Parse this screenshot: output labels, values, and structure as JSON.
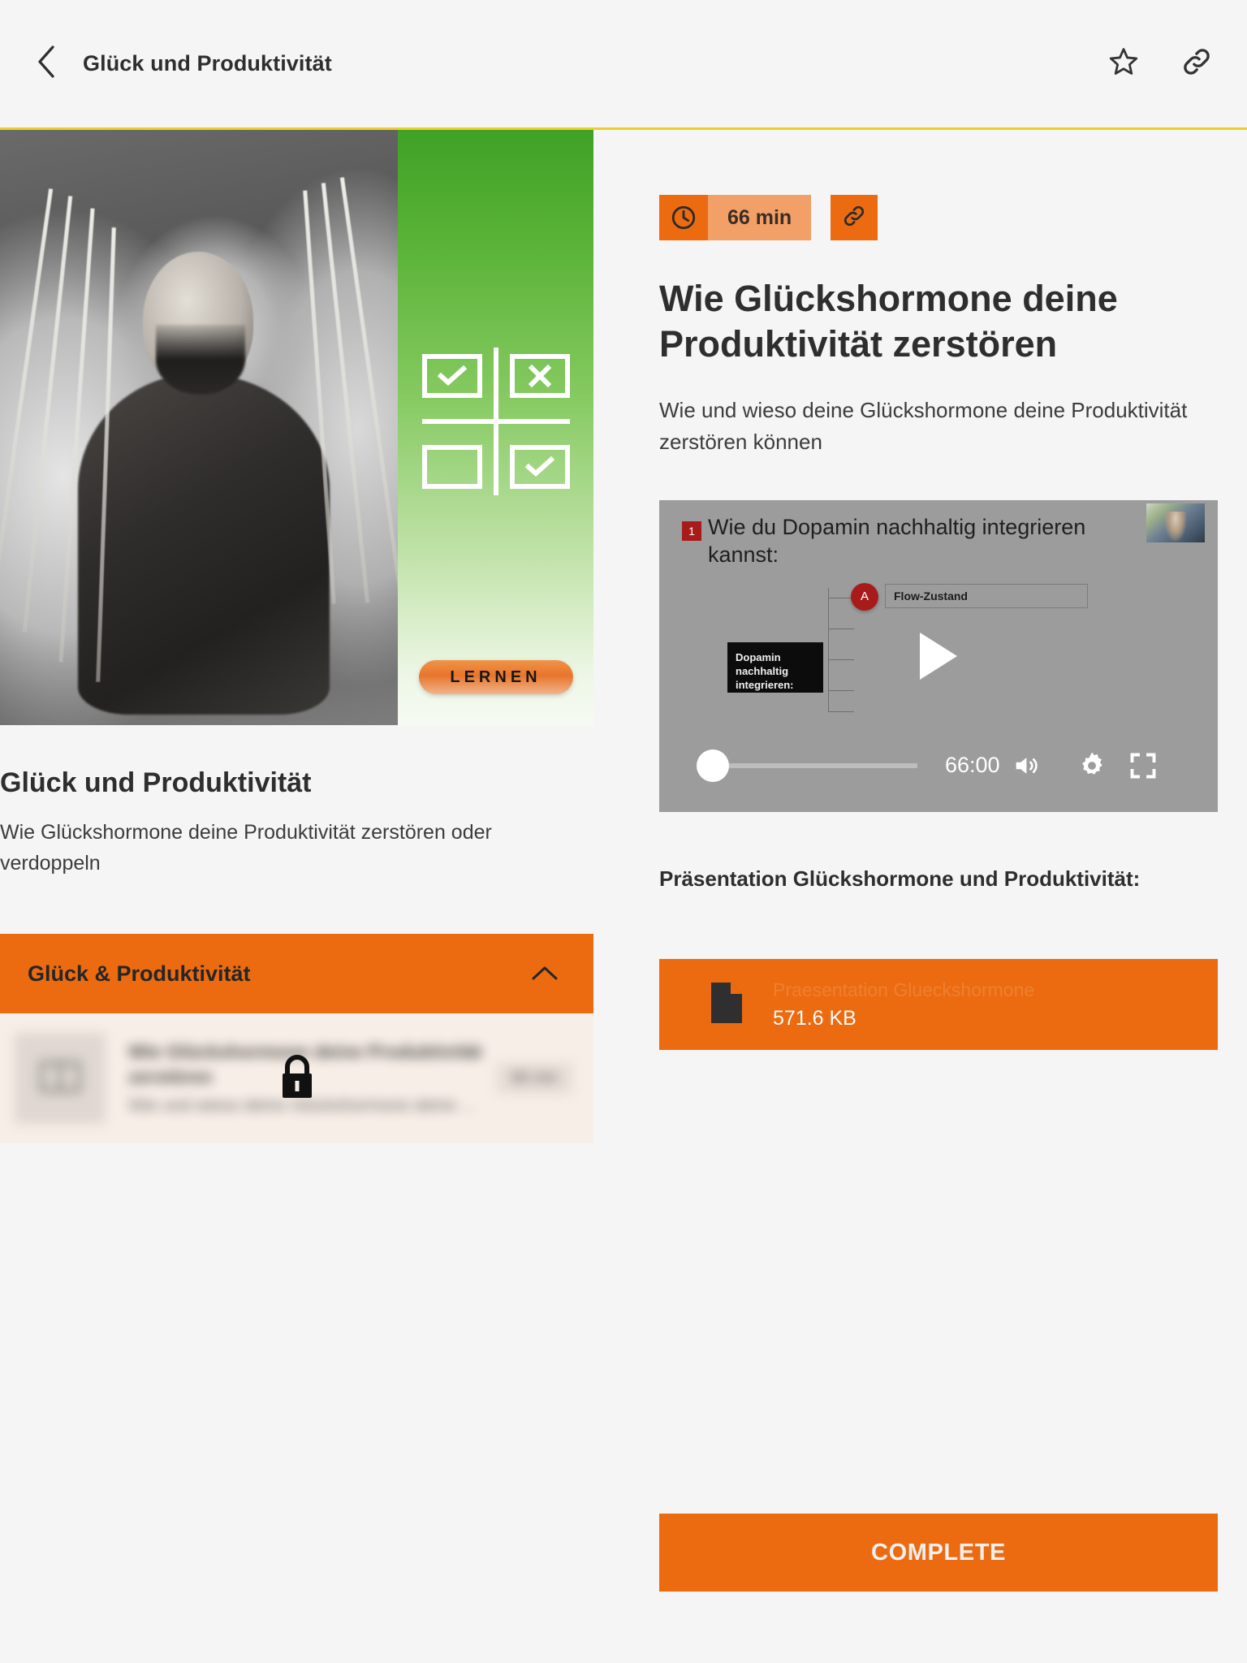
{
  "header": {
    "back_icon": "chevron-left-icon",
    "title": "Glück und Produktivität",
    "favorite_icon": "star-icon",
    "share_icon": "link-icon",
    "divider_color": "#e9cf2b"
  },
  "course": {
    "title": "Glück und Produktivität",
    "description": "Wie Glückshormone deine Produktivität zerstören oder verdoppeln",
    "cover": {
      "photo_alt": "man-in-hammock-photo",
      "badge_label": "LERNEN",
      "matrix_icon": "eisenhower-matrix-icon",
      "matrix_cells": [
        "check",
        "cross",
        "empty",
        "check"
      ],
      "gradient_from": "#3fa127",
      "gradient_to": "#f6faf3"
    },
    "accordion": {
      "label": "Glück & Produktivität",
      "chevron_icon": "chevron-up-icon",
      "expanded": true,
      "bg_color": "#ec6b10"
    },
    "lessons": [
      {
        "thumb_icon": "book-icon",
        "title": "Wie Glückshormone deine Produktivität zerstören",
        "subtitle": "Wie und wieso deine Glückshormone deine ...",
        "duration": "66 min",
        "locked": true,
        "lock_icon": "lock-icon"
      }
    ]
  },
  "lesson": {
    "duration_badge": {
      "icon": "clock-icon",
      "label": "66 min",
      "icon_bg": "#ec6b10",
      "label_bg": "#f2a068"
    },
    "share_button": {
      "icon": "link-icon",
      "bg": "#ec6b10"
    },
    "title": "Wie Glückshormone deine Produktivität zerstören",
    "summary": "Wie und wieso deine Glückshormone deine Produktivität zerstören können",
    "video": {
      "slide_badge": "1",
      "slide_title": "Wie du Dopamin nachhaltig integrieren kannst:",
      "flow_node_label": "A",
      "flow_box_label": "Flow-Zustand",
      "dark_box_label": "Dopamin nachhaltig integrieren:",
      "play_icon": "play-icon",
      "time": "66:00",
      "volume_icon": "volume-icon",
      "settings_icon": "gear-icon",
      "fullscreen_icon": "fullscreen-icon",
      "pip_label": "presenter-webcam-overlay",
      "progress_percent": 0
    },
    "attachment_heading": "Präsentation Glückshormone und Produktivität:",
    "attachment": {
      "icon": "document-icon",
      "filename": "Praesentation Glueckshormone",
      "size": "571.6 KB",
      "bg": "#ec6b10"
    },
    "complete_label": "COMPLETE"
  }
}
